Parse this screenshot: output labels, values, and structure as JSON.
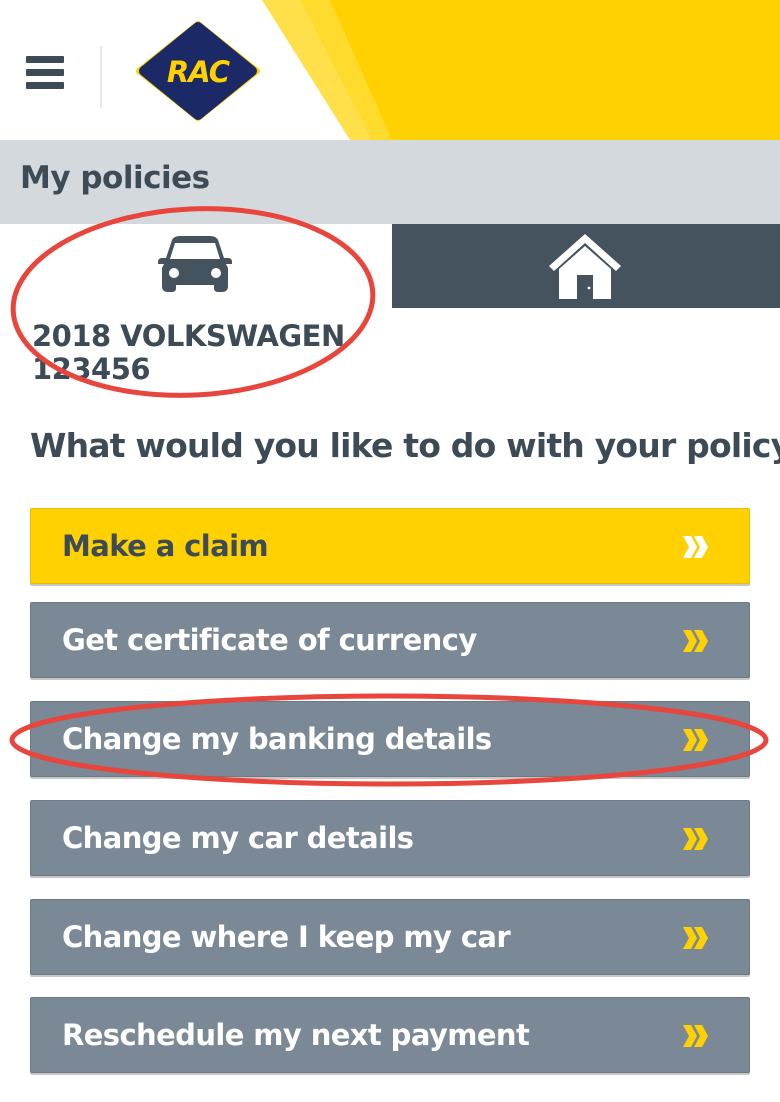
{
  "header": {
    "logo_text": "RAC",
    "menu_icon": "hamburger-menu-icon",
    "colors": {
      "accent": "#ffd100",
      "accent_light": "#ffe04a",
      "dark": "#3d4b57"
    }
  },
  "page_title": "My policies",
  "tabs": [
    {
      "icon": "car-icon",
      "selected": true
    },
    {
      "icon": "house-icon",
      "selected": false
    }
  ],
  "policy": {
    "line1": "2018 VOLKSWAGEN",
    "line2": "123456"
  },
  "question": "What would you like to do with your policy?",
  "actions": [
    {
      "label": "Make a claim",
      "style": "primary",
      "color": "#ffd100",
      "icon": "double-chevron-right-icon"
    },
    {
      "label": "Get certificate of currency",
      "style": "secondary",
      "color": "#7a8995",
      "icon": "double-chevron-right-icon"
    },
    {
      "label": "Change my banking details",
      "style": "secondary",
      "color": "#7a8995",
      "icon": "double-chevron-right-icon"
    },
    {
      "label": "Change my car details",
      "style": "secondary",
      "color": "#7a8995",
      "icon": "double-chevron-right-icon"
    },
    {
      "label": "Change where I keep my car",
      "style": "secondary",
      "color": "#7a8995",
      "icon": "double-chevron-right-icon"
    },
    {
      "label": "Reschedule my next payment",
      "style": "secondary",
      "color": "#7a8995",
      "icon": "double-chevron-right-icon"
    }
  ],
  "annotations": {
    "color": "#e8453c"
  }
}
